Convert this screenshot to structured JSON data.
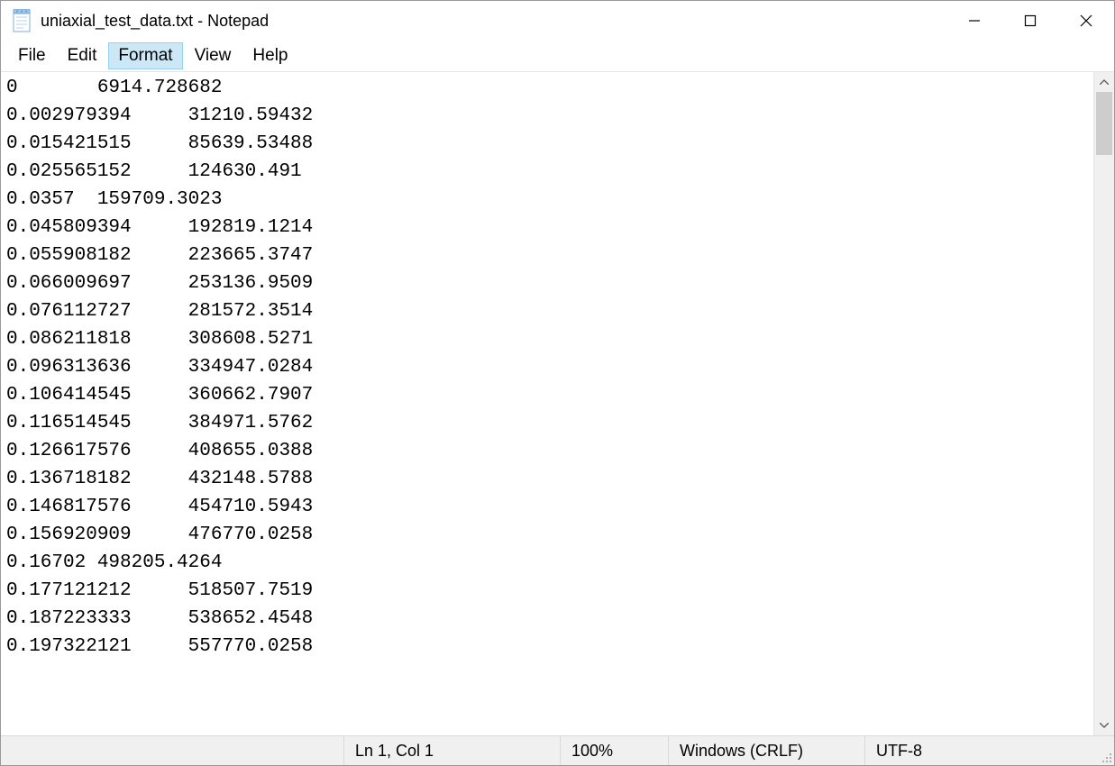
{
  "title": "uniaxial_test_data.txt - Notepad",
  "menu": {
    "file": "File",
    "edit": "Edit",
    "format": "Format",
    "view": "View",
    "help": "Help"
  },
  "content_text": "0\t6914.728682\n0.002979394\t31210.59432\n0.015421515\t85639.53488\n0.025565152\t124630.491\n0.0357\t159709.3023\n0.045809394\t192819.1214\n0.055908182\t223665.3747\n0.066009697\t253136.9509\n0.076112727\t281572.3514\n0.086211818\t308608.5271\n0.096313636\t334947.0284\n0.106414545\t360662.7907\n0.116514545\t384971.5762\n0.126617576\t408655.0388\n0.136718182\t432148.5788\n0.146817576\t454710.5943\n0.156920909\t476770.0258\n0.16702\t498205.4264\n0.177121212\t518507.7519\n0.187223333\t538652.4548\n0.197322121\t557770.0258",
  "status": {
    "position": "Ln 1, Col 1",
    "zoom": "100%",
    "eol": "Windows (CRLF)",
    "encoding": "UTF-8"
  }
}
